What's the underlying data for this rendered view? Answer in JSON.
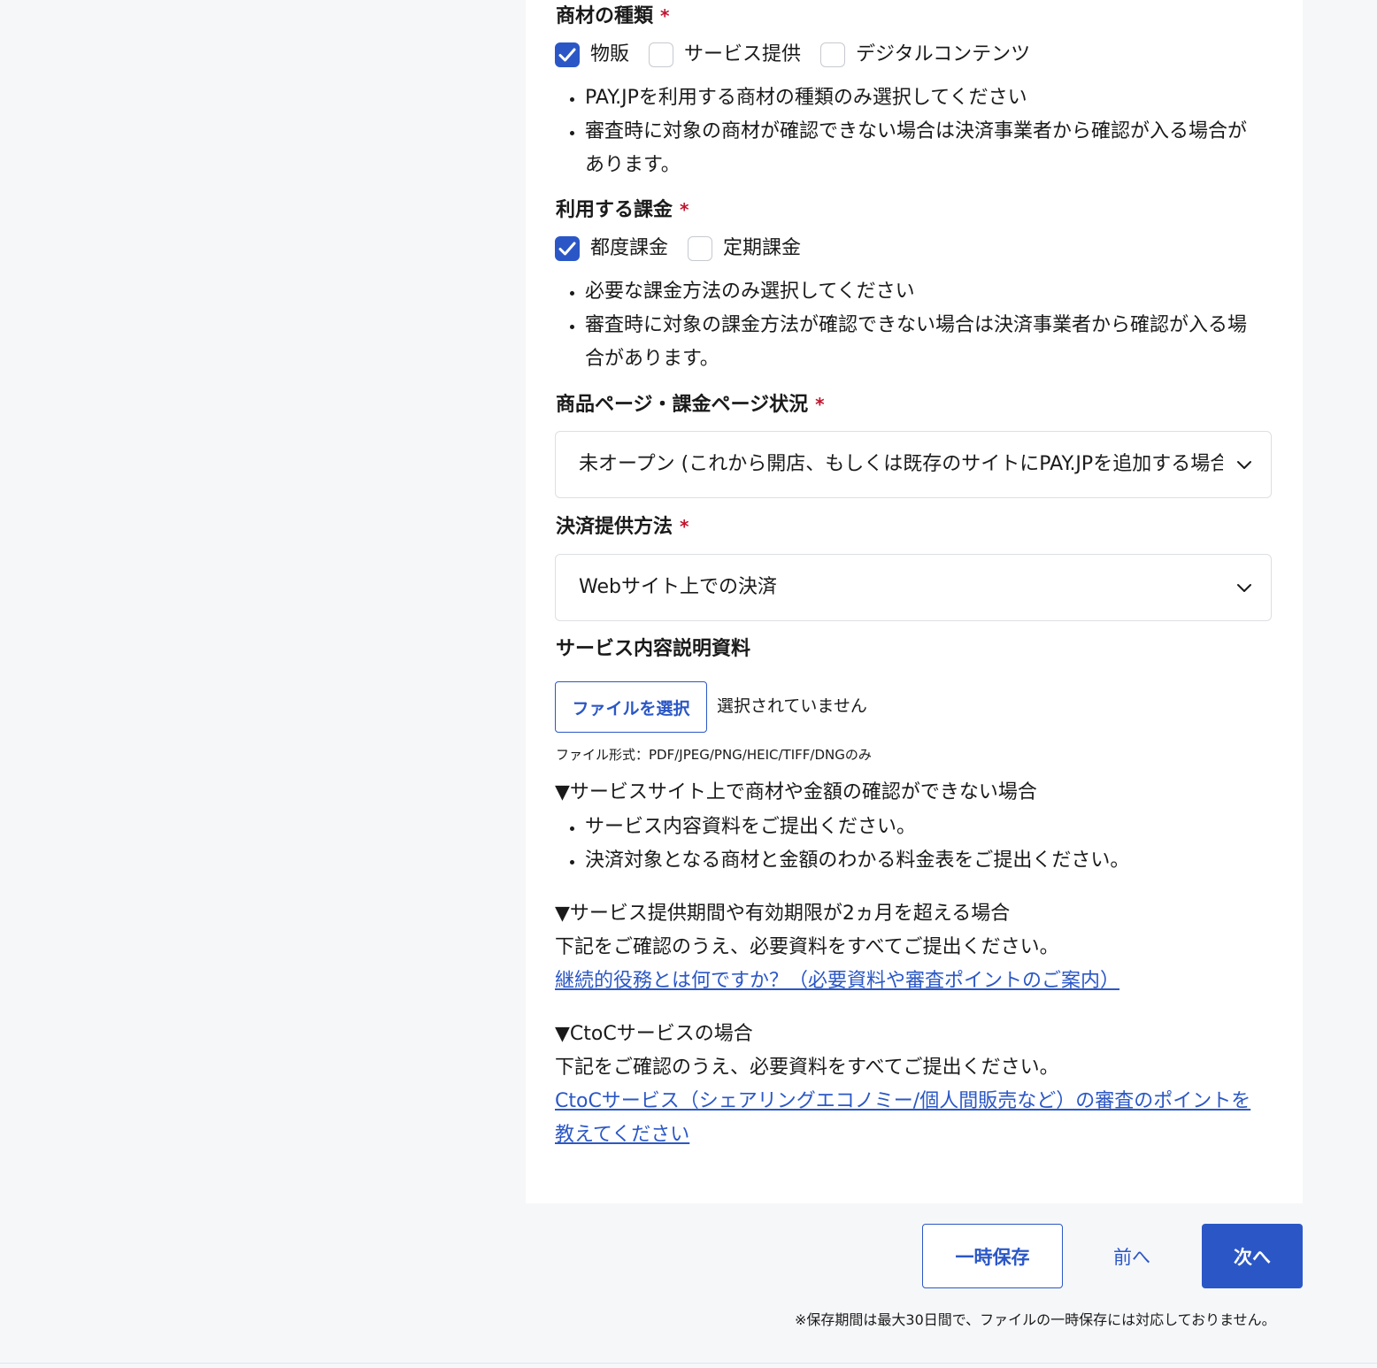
{
  "merchandise_type": {
    "label": "商材の種類",
    "required_mark": "*",
    "options": [
      {
        "label": "物販",
        "checked": true
      },
      {
        "label": "サービス提供",
        "checked": false
      },
      {
        "label": "デジタルコンテンツ",
        "checked": false
      }
    ],
    "notes": [
      "PAY.JPを利用する商材の種類のみ選択してください",
      "審査時に対象の商材が確認できない場合は決済事業者から確認が入る場合があります。"
    ]
  },
  "billing_type": {
    "label": "利用する課金",
    "required_mark": "*",
    "options": [
      {
        "label": "都度課金",
        "checked": true
      },
      {
        "label": "定期課金",
        "checked": false
      }
    ],
    "notes": [
      "必要な課金方法のみ選択してください",
      "審査時に対象の課金方法が確認できない場合は決済事業者から確認が入る場合があります。"
    ]
  },
  "page_status": {
    "label": "商品ページ・課金ページ状況",
    "required_mark": "*",
    "selected": "未オープン (これから開店、もしくは既存のサイトにPAY.JPを追加する場合)"
  },
  "payment_method": {
    "label": "決済提供方法",
    "required_mark": "*",
    "selected": "Webサイト上での決済"
  },
  "service_doc": {
    "label": "サービス内容説明資料",
    "file_button": "ファイルを選択",
    "file_status": "選択されていません",
    "file_hint": "ファイル形式：PDF/JPEG/PNG/HEIC/TIFF/DNGのみ"
  },
  "info": {
    "section1_title": "▼サービスサイト上で商材や金額の確認ができない場合",
    "section1_items": [
      "サービス内容資料をご提出ください。",
      "決済対象となる商材と金額のわかる料金表をご提出ください。"
    ],
    "section2_title": "▼サービス提供期間や有効期限が2ヵ月を超える場合",
    "section2_text": "下記をご確認のうえ、必要資料をすべてご提出ください。",
    "section2_link": "継続的役務とは何ですか？（必要資料や審査ポイントのご案内）",
    "section3_title": "▼CtoCサービスの場合",
    "section3_text": "下記をご確認のうえ、必要資料をすべてご提出ください。",
    "section3_link": "CtoCサービス（シェアリングエコノミー/個人間販売など）の審査のポイントを教えてください"
  },
  "actions": {
    "save_temp": "一時保存",
    "prev": "前へ",
    "next": "次へ",
    "footnote": "※保存期間は最大30日間で、ファイルの一時保存には対応しておりません。"
  },
  "colors": {
    "accent": "#2b57c6",
    "required": "#c0162f",
    "background": "#f6f7f9"
  }
}
